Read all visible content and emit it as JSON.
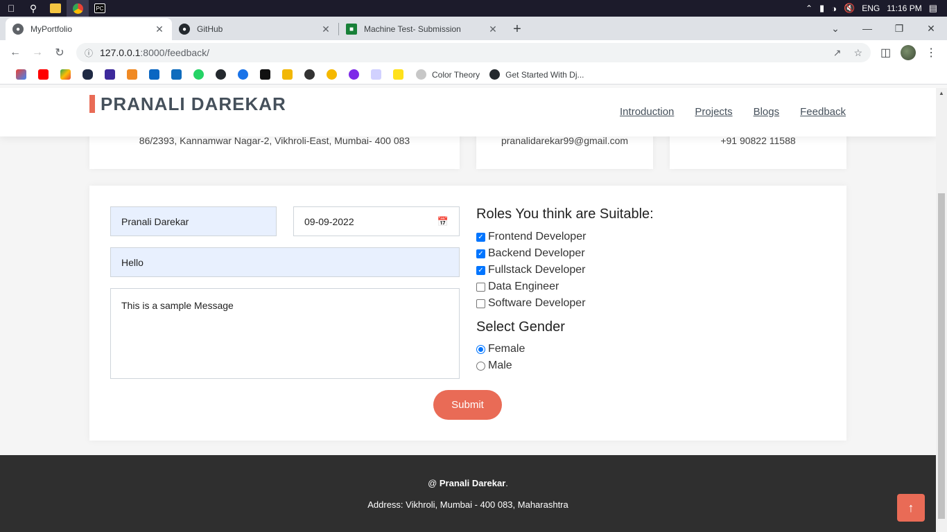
{
  "os": {
    "language": "ENG",
    "time": "11:16 PM"
  },
  "tabs": [
    {
      "title": "MyPortfolio",
      "close": "✕"
    },
    {
      "title": "GitHub",
      "close": "✕"
    },
    {
      "title": "Machine Test- Submission",
      "close": "✕"
    }
  ],
  "address_bar": {
    "host": "127.0.0.1",
    "path": ":8000/feedback/"
  },
  "bookmarks": [
    {
      "label": "Color Theory"
    },
    {
      "label": "Get Started With Dj..."
    }
  ],
  "site": {
    "logo": "PRANALI DAREKAR",
    "nav": [
      "Introduction",
      "Projects",
      "Blogs",
      "Feedback"
    ],
    "info": {
      "address": "86/2393, Kannamwar Nagar-2, Vikhroli-East, Mumbai- 400 083",
      "email": "pranalidarekar99@gmail.com",
      "phone": "+91 90822 11588"
    }
  },
  "form": {
    "name_value": "Pranali Darekar",
    "date_value": "09-09-2022",
    "subject_value": "Hello",
    "message_value": "This is a sample Message",
    "roles_title": "Roles You think are Suitable:",
    "roles": [
      {
        "label": "Frontend Developer",
        "checked": true
      },
      {
        "label": "Backend Developer",
        "checked": true
      },
      {
        "label": "Fullstack Developer",
        "checked": true
      },
      {
        "label": "Data Engineer",
        "checked": false
      },
      {
        "label": "Software Developer",
        "checked": false
      }
    ],
    "gender_title": "Select Gender",
    "genders": [
      {
        "label": "Female",
        "selected": true
      },
      {
        "label": "Male",
        "selected": false
      }
    ],
    "submit_label": "Submit"
  },
  "footer": {
    "prefix": "@ ",
    "name": "Pranali Darekar",
    "suffix": ".",
    "address": "Address: Vikhroli, Mumbai - 400 083, Maharashtra"
  },
  "colors": {
    "accent": "#e96b56",
    "footer_bg": "#2f2f2f",
    "checkbox_blue": "#0075ff"
  }
}
